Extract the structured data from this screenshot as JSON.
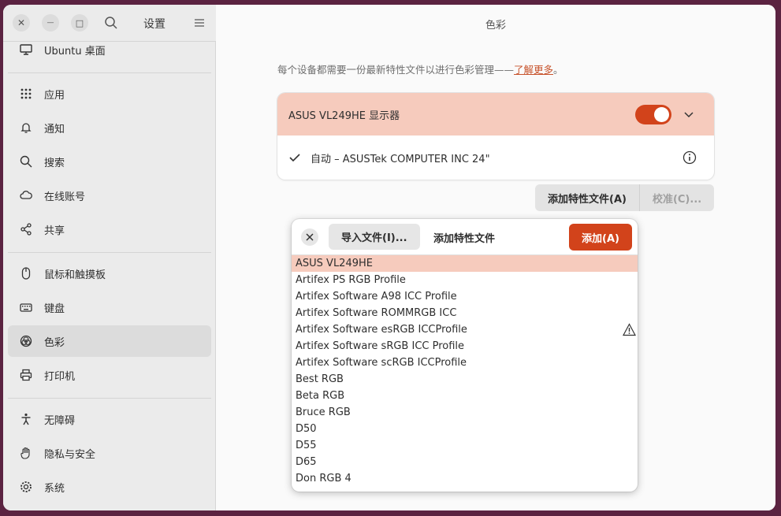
{
  "window": {
    "controls": {
      "close": "✕",
      "minimize": "—",
      "maximize": "□"
    }
  },
  "sidebar": {
    "title": "设置",
    "items": [
      {
        "label": "Ubuntu 桌面",
        "icon": "desktop-icon"
      },
      {
        "label": "应用",
        "icon": "apps-grid-icon"
      },
      {
        "label": "通知",
        "icon": "bell-icon"
      },
      {
        "label": "搜索",
        "icon": "search-icon"
      },
      {
        "label": "在线账号",
        "icon": "cloud-icon"
      },
      {
        "label": "共享",
        "icon": "share-icon"
      },
      {
        "label": "鼠标和触摸板",
        "icon": "mouse-icon"
      },
      {
        "label": "键盘",
        "icon": "keyboard-icon"
      },
      {
        "label": "色彩",
        "icon": "color-icon",
        "active": true
      },
      {
        "label": "打印机",
        "icon": "printer-icon"
      },
      {
        "label": "无障碍",
        "icon": "accessibility-icon"
      },
      {
        "label": "隐私与安全",
        "icon": "hand-icon"
      },
      {
        "label": "系统",
        "icon": "gear-icon"
      }
    ]
  },
  "main": {
    "title": "色彩",
    "description": "每个设备都需要一份最新特性文件以进行色彩管理——",
    "description_link": "了解更多",
    "description_end": "。",
    "device": {
      "name": "ASUS VL249HE 显示器",
      "enabled": true,
      "profile": "自动 – ASUSTek COMPUTER INC 24\""
    },
    "buttons": {
      "add_profile": "添加特性文件(A)",
      "calibrate": "校准(C)..."
    }
  },
  "popover": {
    "import_label": "导入文件(I)...",
    "title": "添加特性文件",
    "add_label": "添加(A)",
    "profiles": [
      "ASUS VL249HE",
      "Artifex PS RGB Profile",
      "Artifex Software A98 ICC Profile",
      "Artifex Software ROMMRGB ICC",
      "Artifex Software esRGB ICCProfile",
      "Artifex Software sRGB ICC Profile",
      "Artifex Software scRGB ICCProfile",
      "Best RGB",
      "Beta RGB",
      "Bruce RGB",
      "D50",
      "D55",
      "D65",
      "Don RGB 4"
    ],
    "selected_index": 0,
    "warning_index": 4
  },
  "colors": {
    "accent": "#d2431b",
    "selection": "#f6cbbd",
    "link": "#c7532c",
    "background": "#5b2341"
  }
}
